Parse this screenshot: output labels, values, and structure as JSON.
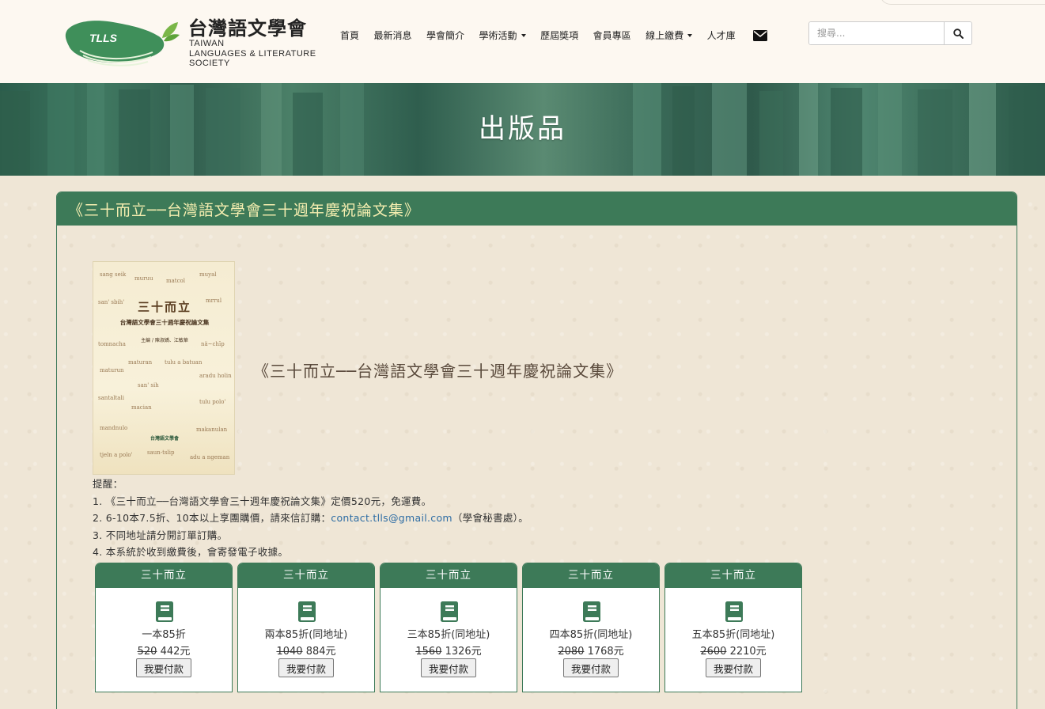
{
  "site": {
    "logo_mark_text": "TLLS",
    "name_cn": "台灣語文學會",
    "name_en_lines": [
      "TAIWAN",
      "LANGUAGES & LITERATURE",
      "SOCIETY"
    ]
  },
  "nav": {
    "items": [
      {
        "label": "首頁"
      },
      {
        "label": "最新消息"
      },
      {
        "label": "學會簡介"
      },
      {
        "label": "學術活動",
        "dropdown": true
      },
      {
        "label": "歷屆獎項"
      },
      {
        "label": "會員專區"
      },
      {
        "label": "線上繳費",
        "dropdown": true
      },
      {
        "label": "人才庫"
      }
    ],
    "mail_icon": "envelope-icon"
  },
  "search": {
    "placeholder": "搜尋...",
    "button_icon": "search-icon"
  },
  "banner": {
    "title": "出版品"
  },
  "panel": {
    "title": "《三十而立──台灣語文學會三十週年慶祝論文集》"
  },
  "cover": {
    "title": "三十而立",
    "subtitle": "台灣語文學會三十週年慶祝論文集",
    "editor": "主編 / 陳淑嬌、江敏華",
    "publisher": "台灣語文學會",
    "scattered_words": [
      "sang seik",
      "muruu",
      "matcol",
      "muyal",
      "san' sbih'",
      "mrrul",
      "tomnacha",
      "nä~chīp",
      "maturun",
      "tulu a batuan",
      "maturan",
      "aradu holin",
      "santaltali",
      "san' sih",
      "tulu polo'",
      "macian",
      "mandnulo",
      "makanulan",
      "tjeln a polo'",
      "saun-tslip",
      "adu a ngeman"
    ]
  },
  "book_heading": "《三十而立──台灣語文學會三十週年慶祝論文集》",
  "notes": {
    "heading": "提醒：",
    "lines": [
      "1. 《三十而立──台灣語文學會三十週年慶祝論文集》定價520元，免運費。",
      "3. 不同地址請分開訂單訂購。",
      "4. 本系統於收到繳費後，會寄發電子收據。"
    ],
    "line2_before": "2. 6-10本7.5折、10本以上享團購價，請來信訂購：",
    "line2_email": "contact.tlls@gmail.com",
    "line2_after": "（學會秘書處）。"
  },
  "cards": [
    {
      "header": "三十而立",
      "label": "一本85折",
      "original_price": "520",
      "price": "442元",
      "button": "我要付款"
    },
    {
      "header": "三十而立",
      "label": "兩本85折(同地址)",
      "original_price": "1040",
      "price": "884元",
      "button": "我要付款"
    },
    {
      "header": "三十而立",
      "label": "三本85折(同地址)",
      "original_price": "1560",
      "price": "1326元",
      "button": "我要付款"
    },
    {
      "header": "三十而立",
      "label": "四本85折(同地址)",
      "original_price": "2080",
      "price": "1768元",
      "button": "我要付款"
    },
    {
      "header": "三十而立",
      "label": "五本85折(同地址)",
      "original_price": "2600",
      "price": "2210元",
      "button": "我要付款"
    }
  ],
  "colors": {
    "brand_green": "#3d7a58",
    "panel_title": "#f5eeb0",
    "link": "#2e6da4",
    "page_bg": "#efe6d6"
  }
}
